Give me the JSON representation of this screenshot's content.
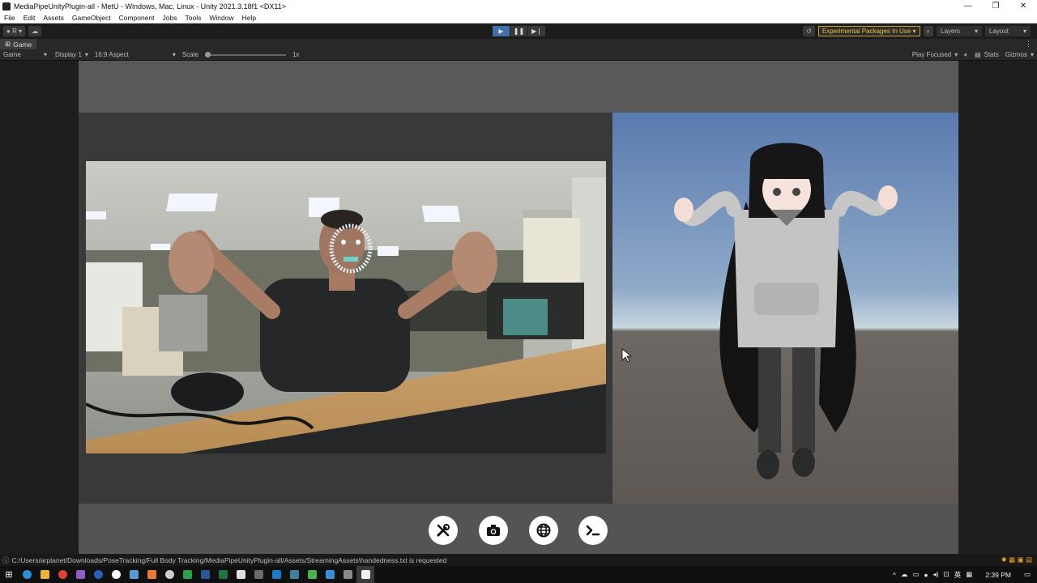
{
  "window": {
    "title": "MediaPipeUnityPlugin-all - MetU - Windows, Mac, Linux - Unity 2021.3.18f1 <DX11>",
    "minimize": "—",
    "restore": "❐",
    "close": "✕"
  },
  "menu": [
    "File",
    "Edit",
    "Assets",
    "GameObject",
    "Component",
    "Jobs",
    "Tools",
    "Window",
    "Help"
  ],
  "toolbar": {
    "account_label": "R",
    "experimental": "Experimental Packages In Use",
    "layers": "Layers",
    "layout": "Layout"
  },
  "tab": {
    "label": "Game"
  },
  "gamebar": {
    "mode": "Game",
    "display": "Display 1",
    "aspect": "16:9 Aspect",
    "scale_label": "Scale",
    "scale_value": "1x",
    "play_focused": "Play Focused",
    "stats": "Stats",
    "gizmos": "Gizmos"
  },
  "scene_buttons": [
    {
      "name": "settings-button",
      "icon": "tools-icon"
    },
    {
      "name": "camera-button",
      "icon": "camera-icon"
    },
    {
      "name": "globe-button",
      "icon": "globe-icon"
    },
    {
      "name": "console-button",
      "icon": "terminal-icon"
    }
  ],
  "status": {
    "message": "C:/Users/arplanet/Downloads/PoseTracking/Full Body Tracking/MediaPipeUnityPlugin-all/Assets/StreamingAssets\\handedness.txt is requested"
  },
  "taskbar": {
    "time": "2:39 PM",
    "ime": "英"
  },
  "colors": {
    "accent": "#3f6fa8",
    "warning": "#f0c040",
    "sky_top": "#5a7bb0",
    "sky_horizon": "#c9d8e0",
    "ground": "#5d5854"
  }
}
